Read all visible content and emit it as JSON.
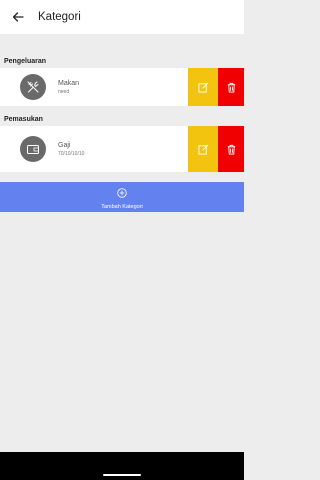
{
  "appbar": {
    "title": "Kategori",
    "back_icon": "arrow-left-icon"
  },
  "sections": [
    {
      "label": "Pengeluaran",
      "items": [
        {
          "name": "Makan",
          "description": "need",
          "icon": "utensils-icon"
        }
      ]
    },
    {
      "label": "Pemasukan",
      "items": [
        {
          "name": "Gaji",
          "description": "70/10/10/10",
          "icon": "wallet-icon"
        }
      ]
    }
  ],
  "add_button": {
    "label": "Tambah Kategori",
    "icon": "plus-circle-icon"
  },
  "colors": {
    "edit": "#f2c40f",
    "delete": "#f00000",
    "add": "#6382f0",
    "avatar": "#6a6a6a"
  }
}
